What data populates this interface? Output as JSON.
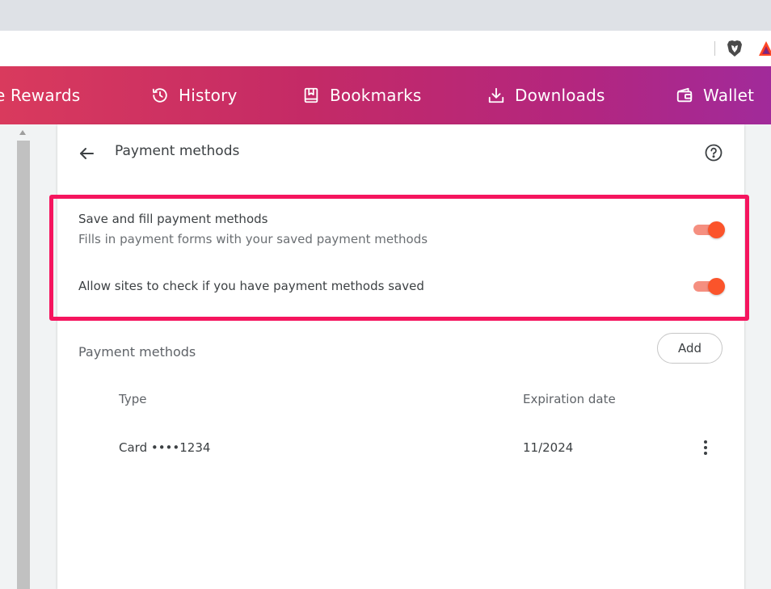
{
  "toolbar": {
    "icons": [
      "brave-lion-icon",
      "bat-rewards-icon"
    ]
  },
  "nav": {
    "items": [
      {
        "label": "e Rewards",
        "icon": null
      },
      {
        "label": "History",
        "icon": "history-icon"
      },
      {
        "label": "Bookmarks",
        "icon": "bookmark-icon"
      },
      {
        "label": "Downloads",
        "icon": "download-icon"
      },
      {
        "label": "Wallet",
        "icon": "wallet-icon"
      }
    ]
  },
  "page": {
    "title": "Payment methods"
  },
  "settings": {
    "save_fill": {
      "title": "Save and fill payment methods",
      "description": "Fills in payment forms with your saved payment methods",
      "enabled": true
    },
    "allow_check": {
      "title": "Allow sites to check if you have payment methods saved",
      "enabled": true
    }
  },
  "payment_methods": {
    "title": "Payment methods",
    "add_label": "Add",
    "columns": {
      "type": "Type",
      "expiration": "Expiration date"
    },
    "rows": [
      {
        "type": "Card ••••1234",
        "expiration": "11/2024"
      }
    ]
  },
  "colors": {
    "accent": "#fb542b",
    "highlight": "#f5155e",
    "nav_gradient_start": "#d93a5d",
    "nav_gradient_end": "#a12a9a"
  }
}
